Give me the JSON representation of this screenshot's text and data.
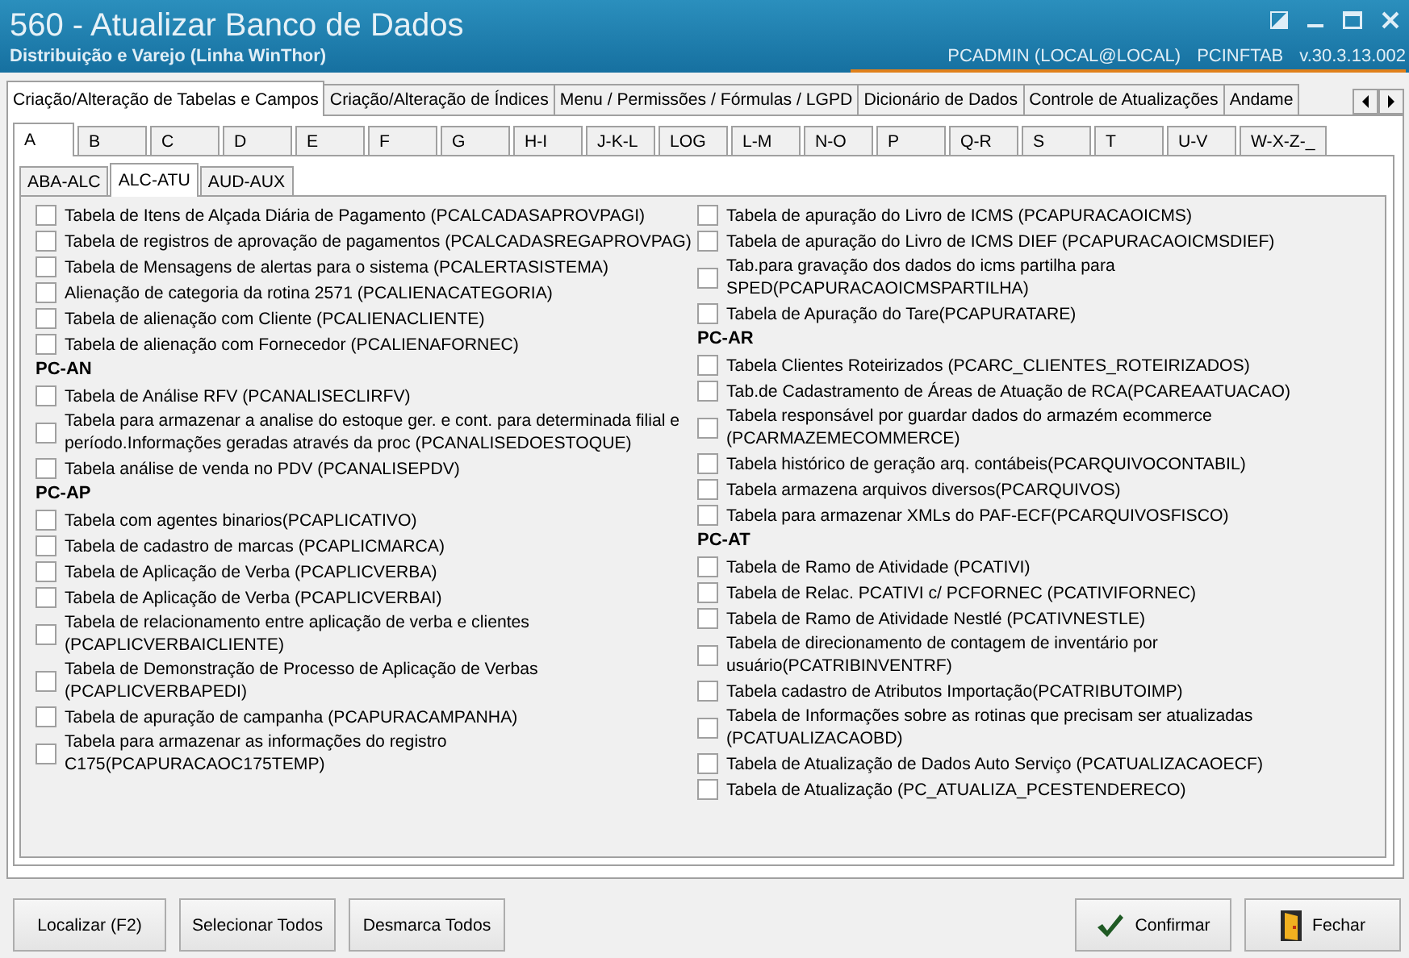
{
  "window": {
    "title": "560 - Atualizar Banco de Dados",
    "subtitle": "Distribuição e Varejo (Linha WinThor)",
    "user": "PCADMIN (LOCAL@LOCAL)",
    "module": "PCINFTAB",
    "version": "v.30.3.13.002"
  },
  "tabs": [
    {
      "label": "Criação/Alteração de Tabelas e Campos",
      "selected": true
    },
    {
      "label": "Criação/Alteração de Índices",
      "selected": false
    },
    {
      "label": "Menu / Permissões / Fórmulas / LGPD",
      "selected": false
    },
    {
      "label": "Dicionário de Dados",
      "selected": false
    },
    {
      "label": "Controle de Atualizações",
      "selected": false
    },
    {
      "label": "Andame",
      "selected": false
    }
  ],
  "letter_tabs": [
    {
      "label": "A",
      "selected": true
    },
    {
      "label": "B",
      "selected": false
    },
    {
      "label": "C",
      "selected": false
    },
    {
      "label": "D",
      "selected": false
    },
    {
      "label": "E",
      "selected": false
    },
    {
      "label": "F",
      "selected": false
    },
    {
      "label": "G",
      "selected": false
    },
    {
      "label": "H-I",
      "selected": false
    },
    {
      "label": "J-K-L",
      "selected": false
    },
    {
      "label": "LOG",
      "selected": false
    },
    {
      "label": "L-M",
      "selected": false
    },
    {
      "label": "N-O",
      "selected": false
    },
    {
      "label": "P",
      "selected": false
    },
    {
      "label": "Q-R",
      "selected": false
    },
    {
      "label": "S",
      "selected": false
    },
    {
      "label": "T",
      "selected": false
    },
    {
      "label": "U-V",
      "selected": false
    },
    {
      "label": "W-X-Z-_",
      "selected": false
    }
  ],
  "sub_tabs": [
    {
      "label": "ABA-ALC",
      "selected": false
    },
    {
      "label": "ALC-ATU",
      "selected": true
    },
    {
      "label": "AUD-AUX",
      "selected": false
    }
  ],
  "columns": [
    [
      {
        "kind": "checkbox",
        "label": "Tabela de Itens de Alçada Diária de Pagamento (PCALCADASAPROVPAGI)",
        "checked": false
      },
      {
        "kind": "checkbox",
        "label": "Tabela de registros de aprovação de pagamentos (PCALCADASREGAPROVPAG)",
        "checked": false
      },
      {
        "kind": "checkbox",
        "label": "Tabela de Mensagens de alertas para o sistema (PCALERTASISTEMA)",
        "checked": false
      },
      {
        "kind": "checkbox",
        "label": "Alienação de categoria da rotina 2571 (PCALIENACATEGORIA)",
        "checked": false
      },
      {
        "kind": "checkbox",
        "label": "Tabela de alienação com Cliente (PCALIENACLIENTE)",
        "checked": false
      },
      {
        "kind": "checkbox",
        "label": "Tabela de alienação com Fornecedor (PCALIENAFORNEC)",
        "checked": false
      },
      {
        "kind": "header",
        "label": "PC-AN"
      },
      {
        "kind": "checkbox",
        "label": "Tabela de Análise RFV (PCANALISECLIRFV)",
        "checked": false
      },
      {
        "kind": "checkbox",
        "label": "Tabela para armazenar a analise do estoque ger. e cont. para determinada filial e período.Informações geradas através da proc (PCANALISEDOESTOQUE)",
        "checked": false
      },
      {
        "kind": "checkbox",
        "label": "Tabela análise de venda no PDV (PCANALISEPDV)",
        "checked": false
      },
      {
        "kind": "header",
        "label": "PC-AP"
      },
      {
        "kind": "checkbox",
        "label": "Tabela com agentes binarios(PCAPLICATIVO)",
        "checked": false
      },
      {
        "kind": "checkbox",
        "label": "Tabela de cadastro de marcas (PCAPLICMARCA)",
        "checked": false
      },
      {
        "kind": "checkbox",
        "label": "Tabela de Aplicação de Verba (PCAPLICVERBA)",
        "checked": false
      },
      {
        "kind": "checkbox",
        "label": "Tabela de Aplicação de Verba (PCAPLICVERBAI)",
        "checked": false
      },
      {
        "kind": "checkbox",
        "label": "Tabela de relacionamento entre aplicação de verba e clientes (PCAPLICVERBAICLIENTE)",
        "checked": false
      },
      {
        "kind": "checkbox",
        "label": "Tabela de Demonstração de Processo de Aplicação de Verbas (PCAPLICVERBAPEDI)",
        "checked": false
      },
      {
        "kind": "checkbox",
        "label": "Tabela de apuração de campanha (PCAPURACAMPANHA)",
        "checked": false
      },
      {
        "kind": "checkbox",
        "label": "Tabela para armazenar as informações do registro C175(PCAPURACAOC175TEMP)",
        "checked": false
      }
    ],
    [
      {
        "kind": "checkbox",
        "label": "Tabela de apuração do Livro de ICMS (PCAPURACAOICMS)",
        "checked": false
      },
      {
        "kind": "checkbox",
        "label": "Tabela de apuração do Livro de ICMS DIEF (PCAPURACAOICMSDIEF)",
        "checked": false
      },
      {
        "kind": "checkbox",
        "label": "Tab.para gravação dos dados do icms partilha para SPED(PCAPURACAOICMSPARTILHA)",
        "checked": false
      },
      {
        "kind": "checkbox",
        "label": "Tabela de Apuração do Tare(PCAPURATARE)",
        "checked": false
      },
      {
        "kind": "header",
        "label": "PC-AR"
      },
      {
        "kind": "checkbox",
        "label": "Tabela Clientes Roteirizados (PCARC_CLIENTES_ROTEIRIZADOS)",
        "checked": false
      },
      {
        "kind": "checkbox",
        "label": "Tab.de Cadastramento de Áreas de Atuação de RCA(PCAREAATUACAO)",
        "checked": false
      },
      {
        "kind": "checkbox",
        "label": "Tabela responsável por guardar dados do armazém ecommerce (PCARMAZEMECOMMERCE)",
        "checked": false
      },
      {
        "kind": "checkbox",
        "label": "Tabela histórico de geração arq. contábeis(PCARQUIVOCONTABIL)",
        "checked": false
      },
      {
        "kind": "checkbox",
        "label": "Tabela armazena arquivos diversos(PCARQUIVOS)",
        "checked": false
      },
      {
        "kind": "checkbox",
        "label": "Tabela para armazenar XMLs do PAF-ECF(PCARQUIVOSFISCO)",
        "checked": false
      },
      {
        "kind": "header",
        "label": "PC-AT"
      },
      {
        "kind": "checkbox",
        "label": "Tabela de Ramo de Atividade (PCATIVI)",
        "checked": false
      },
      {
        "kind": "checkbox",
        "label": "Tabela de Relac. PCATIVI c/ PCFORNEC (PCATIVIFORNEC)",
        "checked": false
      },
      {
        "kind": "checkbox",
        "label": "Tabela de Ramo de Atividade Nestlé (PCATIVNESTLE)",
        "checked": false
      },
      {
        "kind": "checkbox",
        "label": "Tabela de direcionamento de contagem de inventário por usuário(PCATRIBINVENTRF)",
        "checked": false
      },
      {
        "kind": "checkbox",
        "label": "Tabela cadastro de Atributos Importação(PCATRIBUTOIMP)",
        "checked": false
      },
      {
        "kind": "checkbox",
        "label": "Tabela de Informações sobre as rotinas que precisam ser atualizadas (PCATUALIZACAOBD)",
        "checked": false
      },
      {
        "kind": "checkbox",
        "label": "Tabela  de Atualização de Dados Auto Serviço (PCATUALIZACAOECF)",
        "checked": false
      },
      {
        "kind": "checkbox",
        "label": "Tabela de Atualização (PC_ATUALIZA_PCESTENDERECO)",
        "checked": false
      }
    ]
  ],
  "buttons": [
    {
      "label": "Localizar (F2)",
      "kind": "plain"
    },
    {
      "label": "Selecionar Todos",
      "kind": "plain"
    },
    {
      "label": "Desmarca Todos",
      "kind": "plain"
    },
    {
      "label": "Confirmar",
      "kind": "confirm"
    },
    {
      "label": "Fechar",
      "kind": "close"
    }
  ]
}
